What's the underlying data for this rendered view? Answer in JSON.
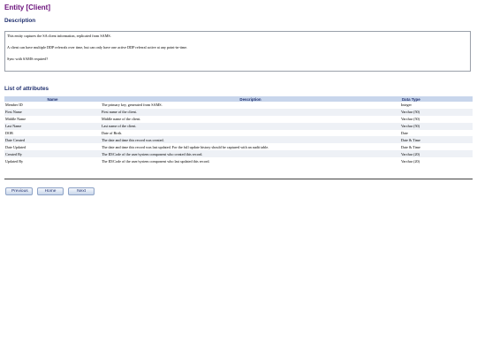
{
  "header": {
    "title": "Entity [Client]"
  },
  "description": {
    "heading": "Description",
    "paragraphs": [
      "This entity captures the SA client information, replicated from SAMS.",
      "A client can have multiple DDP referrals over time, but can only have one active DDP referral active at any point-in-time.",
      "Sync with SAMS required?"
    ]
  },
  "attributes": {
    "heading": "List of attributes",
    "columns": [
      "Name",
      "Description",
      "Data Type"
    ],
    "rows": [
      {
        "name": "Member ID",
        "description": "The primary key, generated from SAMS.",
        "type": "Integer"
      },
      {
        "name": "First Name",
        "description": "First name of the client.",
        "type": "Varchar (50)"
      },
      {
        "name": "Middle Name",
        "description": "Middle name of the client.",
        "type": "Varchar (50)"
      },
      {
        "name": "Last Name",
        "description": "Last name of the client.",
        "type": "Varchar (50)"
      },
      {
        "name": "DOB",
        "description": "Date of Birth.",
        "type": "Date"
      },
      {
        "name": "Date Created",
        "description": "The date and time this record was created.",
        "type": "Date & Time"
      },
      {
        "name": "Date Updated",
        "description": "The date and time this record was last updated. For the full update history should be captured with an audit table.",
        "type": "Date & Time"
      },
      {
        "name": "Created By",
        "description": "The ID/Code of the user/system component who created this record.",
        "type": "Varchar (20)"
      },
      {
        "name": "Updated By",
        "description": "The ID/Code of the user/system component who last updated this record.",
        "type": "Varchar (20)"
      }
    ]
  },
  "nav": {
    "previous": "Previous",
    "home": "Home",
    "next": "Next"
  }
}
